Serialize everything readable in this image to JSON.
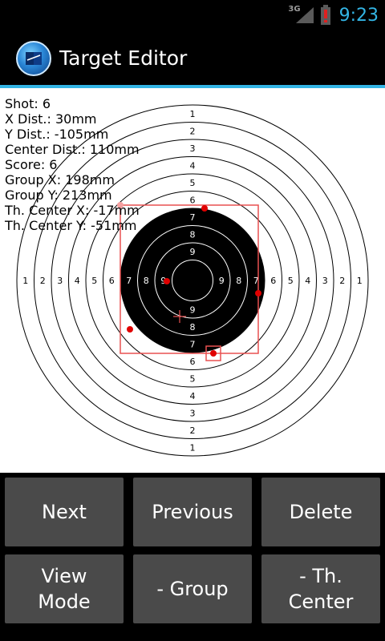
{
  "status_bar": {
    "network": "3G",
    "time": "9:23",
    "icons": [
      "signal-icon",
      "battery-low-icon"
    ],
    "clock_color": "#33b5e5"
  },
  "title_bar": {
    "app_name": "Target Editor",
    "icon": "target-app-icon"
  },
  "info": {
    "shot": "Shot: 6",
    "x_dist": "X Dist.: 30mm",
    "y_dist": "Y Dist.: -105mm",
    "center_dist": "Center Dist.: 110mm",
    "score": "Score: 6",
    "group_x": "Group X: 198mm",
    "group_y": "Group Y: 213mm",
    "th_center_x": "Th. Center X: -17mm",
    "th_center_y": "Th. Center Y: -51mm"
  },
  "target": {
    "ring_labels": [
      "1",
      "2",
      "3",
      "4",
      "5",
      "6",
      "7",
      "8",
      "9"
    ],
    "shot_color": "#e00000",
    "group_box_color": "#e85050",
    "black_rings_from": 7
  },
  "buttons": {
    "next": "Next",
    "previous": "Previous",
    "delete": "Delete",
    "view_mode_line1": "View",
    "view_mode_line2": "Mode",
    "group": "- Group",
    "th_center_line1": "- Th.",
    "th_center_line2": "Center"
  }
}
